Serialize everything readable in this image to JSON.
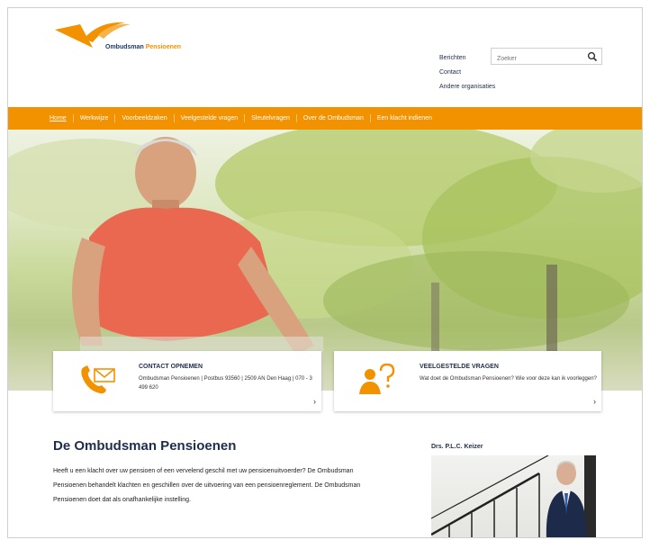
{
  "brand": {
    "name_part1": "Ombudsman",
    "name_part2": "Pensioenen",
    "accent_color": "#f39200",
    "navy_color": "#1f2d4d"
  },
  "header": {
    "util_links": [
      "Berichten",
      "Contact",
      "Andere organisaties"
    ],
    "search": {
      "placeholder": "Zoeker"
    }
  },
  "nav": {
    "items": [
      "Home",
      "Werkwijze",
      "Voorbeeldzaken",
      "Veelgestelde vragen",
      "Sleutelvragen",
      "Over de Ombudsman",
      "Een klacht indienen"
    ]
  },
  "cards": {
    "contact": {
      "title": "CONTACT OPNEMEN",
      "text": "Ombudsman Pensioenen | Postbus 93560 | 2509 AN Den Haag | 070 - 3 499 620",
      "icon": "phone-mail-icon"
    },
    "faq": {
      "title": "VEELGESTELDE VRAGEN",
      "text": "Wat doet de Ombudsman Pensioenen? Wie voor deze kan ik voorleggen?",
      "icon": "person-question-icon"
    }
  },
  "main": {
    "title": "De Ombudsman Pensioenen",
    "body": "Heeft u een klacht over uw pensioen of een vervelend geschil met uw pensioenuitvoerder? De Ombudsman Pensioenen behandelt klachten en geschillen over de uitvoering van een pensioenreglement. De Ombudsman Pensioenen doet dat als onafhankelijke instelling."
  },
  "sidebar": {
    "title": "Drs. P.L.C. Keizer"
  }
}
